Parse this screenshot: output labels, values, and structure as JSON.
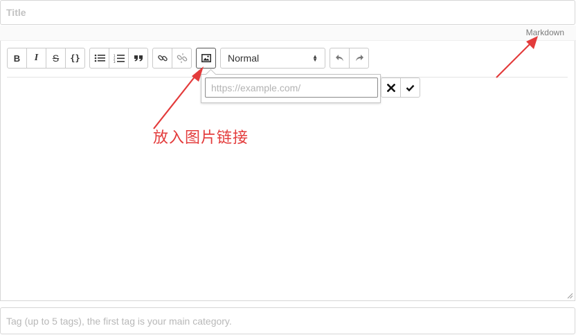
{
  "title_field": {
    "placeholder": "Title",
    "value": ""
  },
  "mode_switch": {
    "label": "Markdown"
  },
  "toolbar": {
    "bold_label": "B",
    "italic_label": "I",
    "strike_label": "S",
    "code_label": "{}",
    "block_format": {
      "selected": "Normal"
    }
  },
  "link_popup": {
    "url_placeholder": "https://example.com/",
    "url_value": ""
  },
  "annotation": {
    "text": "放入图片链接",
    "color": "#e33b3b"
  },
  "tags_field": {
    "placeholder": "Tag (up to 5 tags), the first tag is your main category.",
    "value": ""
  },
  "colors": {
    "accent_red": "#e33b3b",
    "border": "#d6d6d6"
  }
}
